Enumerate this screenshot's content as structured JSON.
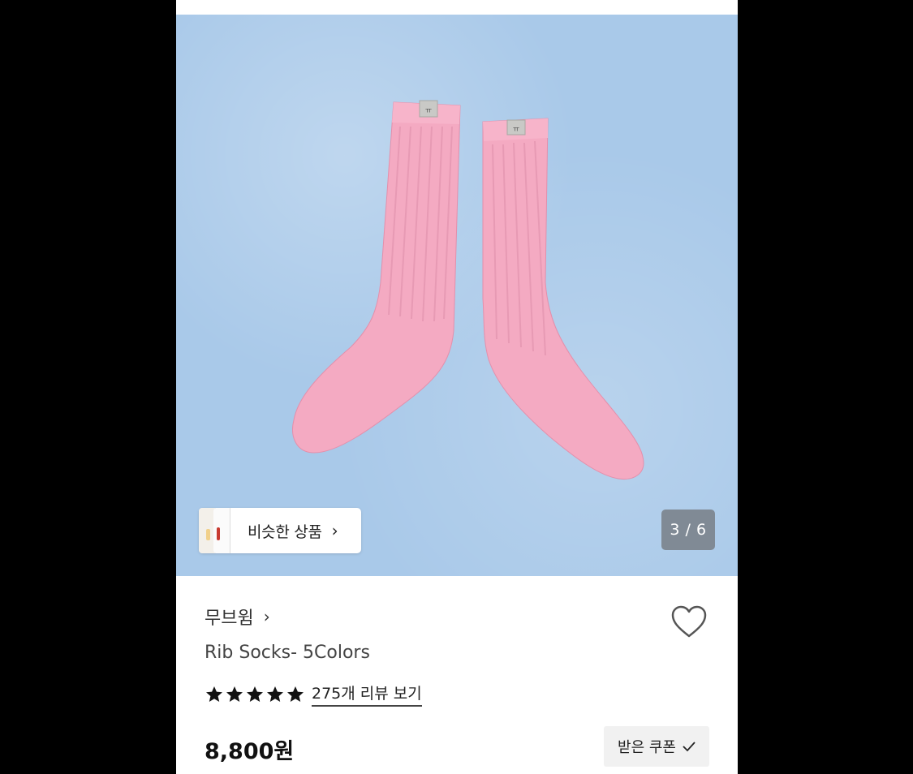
{
  "gallery": {
    "similar_label": "비슷한 상품",
    "counter": "3 / 6",
    "current_image": 3,
    "total_images": 6
  },
  "product": {
    "brand": "무브윔",
    "title": "Rib Socks- 5Colors",
    "rating_stars": 5,
    "review_link": "275개 리뷰 보기",
    "price": "8,800원",
    "coupon_label": "받은 쿠폰"
  },
  "icons": {
    "chevron": "chevron-right-icon",
    "heart": "heart-outline-icon",
    "star": "star-filled-icon",
    "check": "check-icon"
  },
  "colors": {
    "background": "#a9c9e9",
    "sock_pink": "#f4aac2"
  }
}
